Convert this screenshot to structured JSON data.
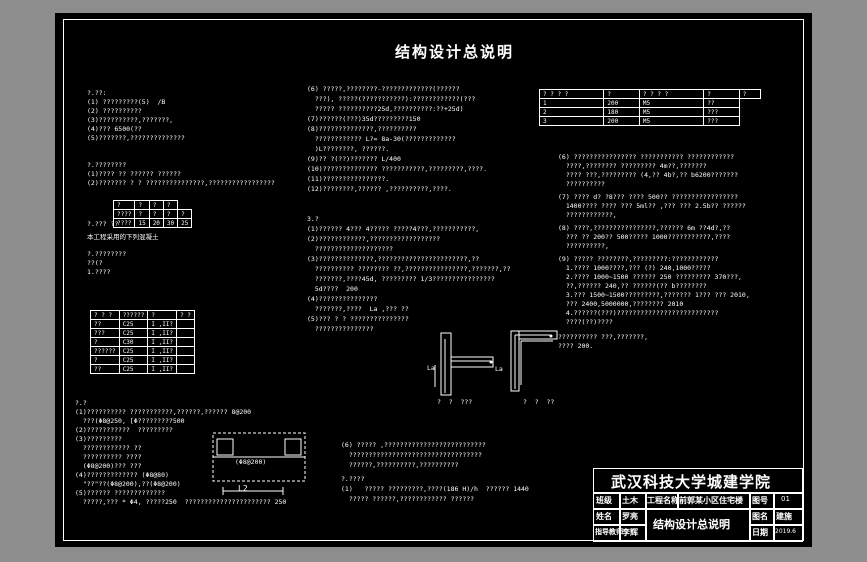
{
  "drawing": {
    "title": "结构设计总说明",
    "col1": [
      "?.??:",
      "(1) ?????????(5)  /B",
      "(2) ??????????",
      "(3)??????????,???????,",
      "(4)??? 6500(??",
      "(5)???????,??????????????",
      "?.????????",
      "(1)???? ?? ?????? ??????",
      "(2)??????? ? ? ???????????????,?????????????????",
      "?.??? ??",
      "本工程采用的下列混凝土",
      "?.????????",
      "??(?",
      "1.????"
    ],
    "table_a": [
      [
        "?",
        "?",
        "?",
        "?"
      ],
      [
        "????",
        "?",
        "?",
        "?",
        "?"
      ],
      [
        "????",
        "15",
        "20",
        "30",
        "25"
      ]
    ],
    "table_b": [
      [
        "?  ?  ?",
        "??????",
        "?",
        "?  ?"
      ],
      [
        "??",
        "C25",
        "I ,II?",
        ""
      ],
      [
        "???",
        "C25",
        "I ,II?",
        ""
      ],
      [
        "?",
        "C30",
        "I ,II?",
        ""
      ],
      [
        "??????",
        "C25",
        "I ,II?",
        ""
      ],
      [
        "?",
        "C25",
        "I ,II?",
        ""
      ],
      [
        "??",
        "C25",
        "I ,II?",
        ""
      ]
    ],
    "col1_lower": [
      "?.?",
      "(1)?????????? ???????????,??????,?????? 8@200",
      "  ???(Φ8@250, [Φ?????????500",
      "(2)???????????  ?????????",
      "(3)?????????",
      "  ???????????? ??",
      "  ?????????? ????",
      "  (Φ8@200)??? ???",
      "(4)????????????? (Φ8@80)",
      "  \"??\"??(Φ8@200),??(Φ8@200)",
      "(5)?????? ?????????????",
      "  ?????,??? * Φ4, ?????250  ?????????????????????? 250"
    ],
    "col2": [
      "(6) ?????,????????-?????????????(??????",
      "  ???), ?????(???????????):????????????(???",
      "  ????? ??????????25d,??????????:??+25d)",
      "(7)??????(???)35d?????????150",
      "(8)??????????????,??????????",
      "  ???????????? L?= 8a-30(?????????????",
      "  )L????????, ??????.",
      "(9)?? ?(??)??????? L/400",
      "(10)?????????????? ???????????,?????????,????.",
      "(11)????????????????.",
      "(12)????????,?????? ,??????????,????.",
      "3.?",
      "(1)?????? 4??? 4????? ?????4???,???????????,",
      "(2)????????????,??????????????????",
      "  ????????????????????",
      "(3)??????????????,???????????????????????,??",
      "  ?????????? ???????? ??,????????????????,???????,??",
      "  ???????,????45d, ????????? 1/3????????????????",
      "  5d????  200",
      "(4)???????????????",
      "  ???????,????  La ,??? ??",
      "(5)??? ? ? ???????????????",
      "  ???????????????"
    ],
    "col2_lower": [
      "(6) ????? ,??????????????????????????",
      "  ??????????????????????????????????",
      "  ??????,??????????,??????????",
      "?.????",
      "(1)   ????? ?????????,????(186 H)/h  ?????? 1440",
      "  ????? ??????,???????????? ??????"
    ],
    "table_c": [
      [
        "?  ?  ?  ?",
        "?",
        "?  ?  ?  ?",
        "?",
        "?"
      ],
      [
        "1",
        "200",
        "M5",
        "??"
      ],
      [
        "2",
        "180",
        "M5",
        "???"
      ],
      [
        "3",
        "200",
        "M5",
        "???"
      ]
    ],
    "col3": [
      "(6) ???????????????? ??????????? ????????????",
      "  ????,???????? ????????? 4m??,???????",
      "  ???? ???,????????? (4,?? 4b?,?? b6200???????",
      "  ??????????",
      "(7) ???? d? ?8??? ???? 500?? ?????????????????",
      "  1400???? ???? ??? 5ml?? ,??? ??? 2.5b?? ??????",
      "  ????????????,",
      "(8) ????,????????????????,?????? 6m ??4d?,??",
      "  ??? ?? 200?? 500????? 1000???????????,????",
      "  ??????????,",
      "(9) ????? ????????,?????????:????????????",
      "  1.???? 1000????,??? (?) 240,1000?????",
      "  2.???? 1000~1500 ?????? 250 ????????? 370???,",
      "  ??,?????? 240,?? ??????(?? b????????",
      "  3.??? 1500~1500?????????,??????? 1??? ??? 2010,",
      "  ??? 2400,5000000,???????? 2010",
      "  4.??????(???)??????????????????????????",
      "  ????(??)????",
      "?????????? ???,???????,",
      "???? 200."
    ],
    "details": {
      "d1_label": "?  ?  ???",
      "d2_label": "?  ?  ??",
      "la": "La",
      "l2": "L2",
      "bar_note": "(Φ8@200)"
    },
    "titleblock": {
      "school": "武汉科技大学城建学院",
      "course_label": "班级",
      "course_value": "土木",
      "project_label": "工程名称",
      "project_value": "前郭某小区住宅楼",
      "name_label": "姓名",
      "name_value": "罗亮",
      "advisor_label": "指导教师",
      "advisor_value": "李辉",
      "drawing_title": "结构设计总说明",
      "sheet_no_label": "图号",
      "sheet_no_value": "01",
      "scale_label": "图名",
      "scale_value": "建施",
      "date_label": "日期",
      "date_value": "2019.6"
    },
    "colors": {
      "paper": "#000000",
      "line": "#ffffff",
      "surround": "#8e8e8e"
    }
  }
}
